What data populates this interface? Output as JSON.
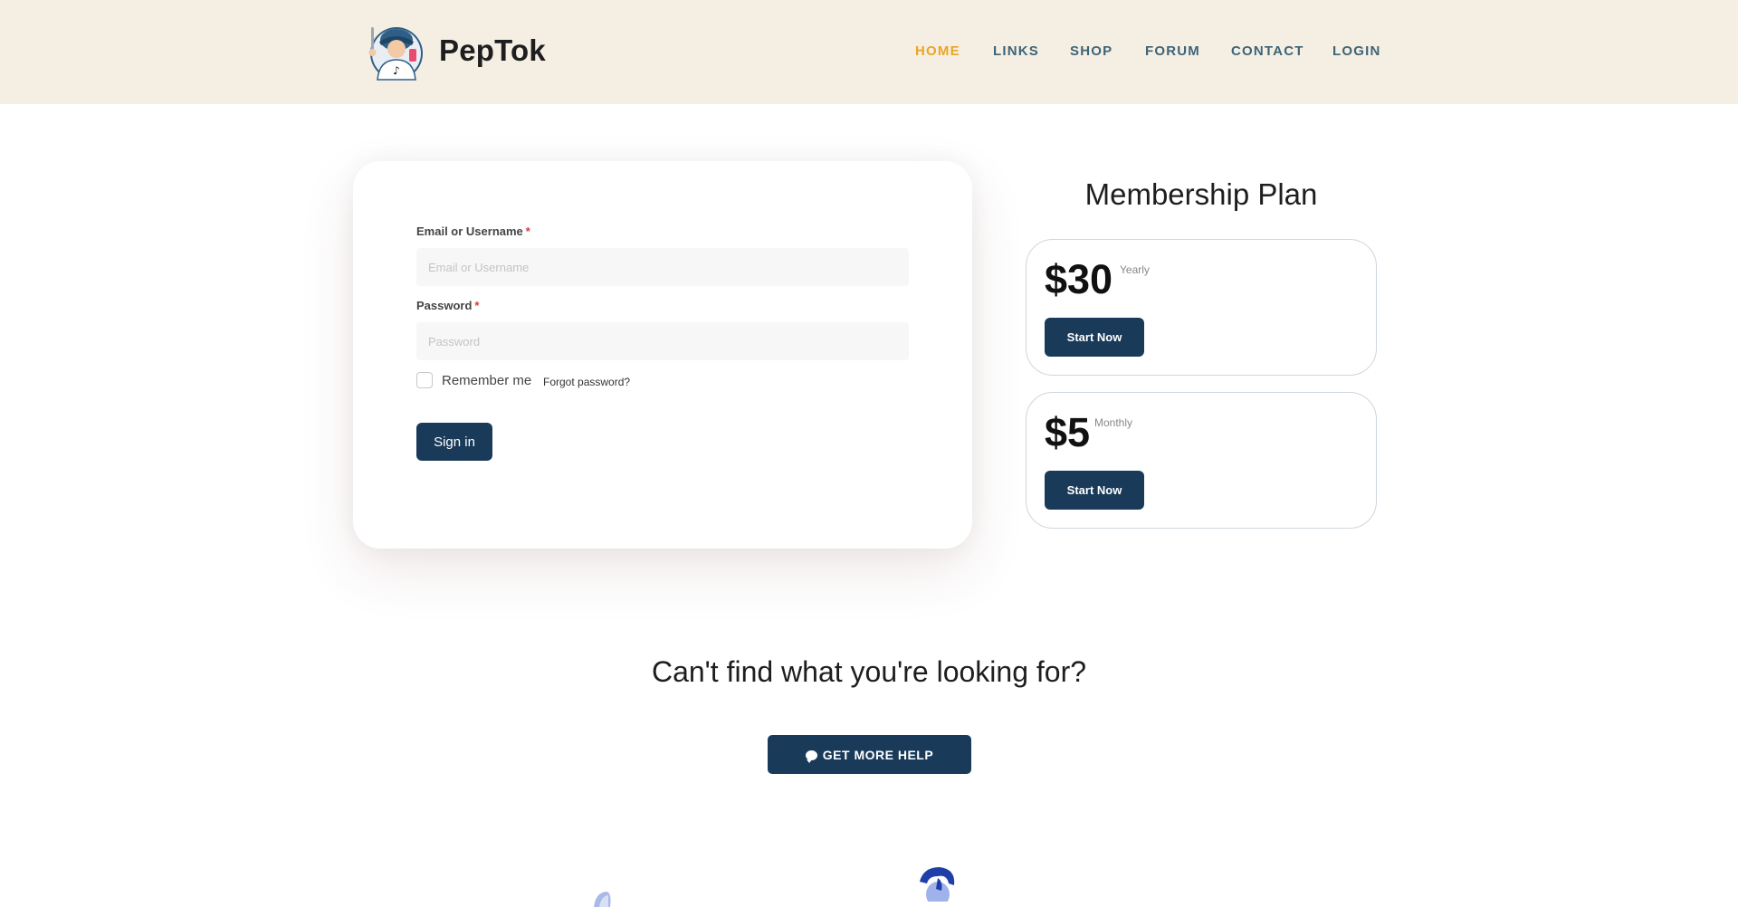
{
  "brand": {
    "name": "PepTok",
    "logo_icon": "mascot-tiktok-logo-icon"
  },
  "nav": [
    {
      "label": "HOME",
      "active": true
    },
    {
      "label": "LINKS",
      "active": false
    },
    {
      "label": "SHOP",
      "active": false
    },
    {
      "label": "FORUM",
      "active": false
    },
    {
      "label": "CONTACT",
      "active": false
    },
    {
      "label": "LOGIN",
      "active": false
    }
  ],
  "login": {
    "email_label": "Email or Username",
    "email_placeholder": "Email or Username",
    "email_value": "",
    "password_label": "Password",
    "password_placeholder": "Password",
    "password_value": "",
    "required_mark": "*",
    "remember_label": "Remember me",
    "remember_checked": false,
    "forgot_label": "Forgot password?",
    "signin_label": "Sign in"
  },
  "membership": {
    "title": "Membership Plan",
    "plans": [
      {
        "price": "$30",
        "period": "Yearly",
        "cta": "Start Now"
      },
      {
        "price": "$5",
        "period": "Monthly",
        "cta": "Start Now"
      }
    ]
  },
  "help": {
    "heading": "Can't find what you're looking for?",
    "button_label": "GET MORE HELP",
    "button_icon": "chat-bubble-icon"
  },
  "colors": {
    "header_bg": "#f5eee3",
    "nav_text": "#3d6478",
    "nav_active": "#e8a724",
    "primary_button": "#193a59",
    "required": "#d63b3b"
  }
}
